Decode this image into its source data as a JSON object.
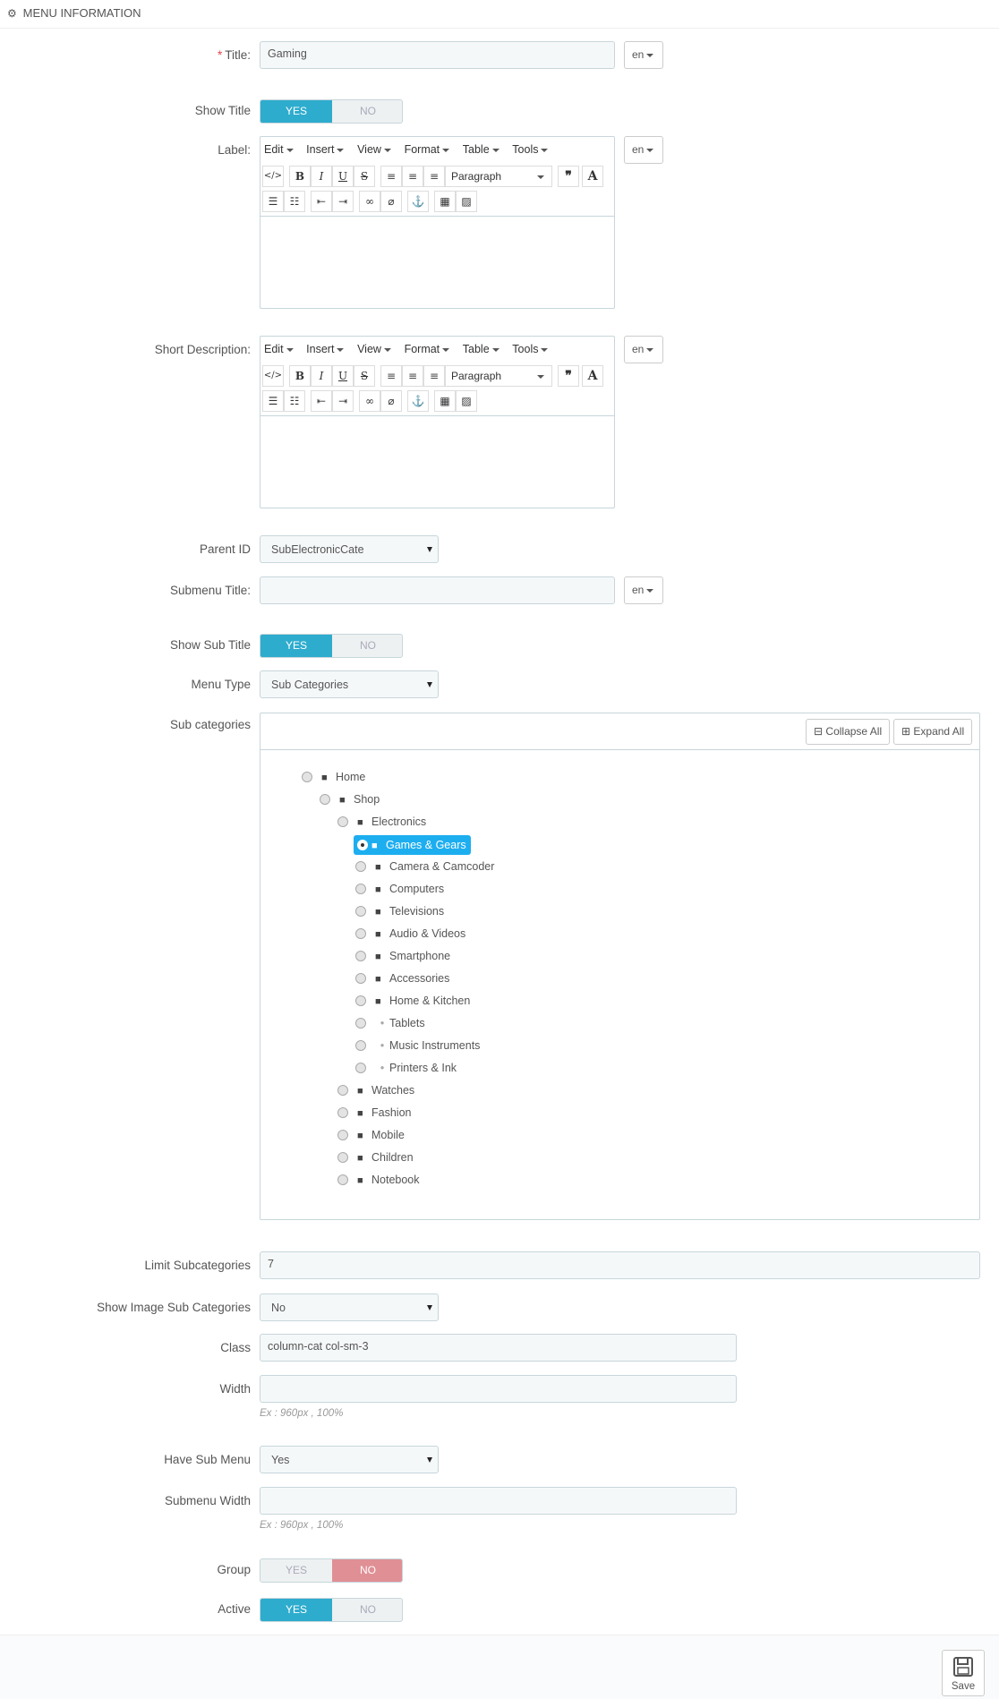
{
  "panel": {
    "heading": "MENU INFORMATION",
    "icon": "cogs-icon"
  },
  "fields": {
    "title": {
      "label": "Title:",
      "required_mark": "*",
      "value": "Gaming",
      "lang": "en"
    },
    "show_title": {
      "label": "Show Title",
      "yes": "YES",
      "no": "NO",
      "selected": "YES"
    },
    "label": {
      "label": "Label:",
      "lang": "en"
    },
    "short_description": {
      "label": "Short Description:",
      "lang": "en"
    },
    "parent_id": {
      "label": "Parent ID",
      "value": "SubElectronicCate"
    },
    "submenu_title": {
      "label": "Submenu Title:",
      "value": "",
      "lang": "en"
    },
    "show_sub_title": {
      "label": "Show Sub Title",
      "yes": "YES",
      "no": "NO",
      "selected": "YES"
    },
    "menu_type": {
      "label": "Menu Type",
      "value": "Sub Categories"
    },
    "sub_categories": {
      "label": "Sub categories",
      "collapse_all": "Collapse All",
      "expand_all": "Expand All"
    },
    "limit_subcategories": {
      "label": "Limit Subcategories",
      "value": "7"
    },
    "show_image_sub_categories": {
      "label": "Show Image Sub Categories",
      "value": "No"
    },
    "class": {
      "label": "Class",
      "value": "column-cat col-sm-3"
    },
    "width": {
      "label": "Width",
      "value": "",
      "help": "Ex : 960px , 100%"
    },
    "have_sub_menu": {
      "label": "Have Sub Menu",
      "value": "Yes"
    },
    "submenu_width": {
      "label": "Submenu Width",
      "value": "",
      "help": "Ex : 960px , 100%"
    },
    "group": {
      "label": "Group",
      "yes": "YES",
      "no": "NO",
      "selected": "NO"
    },
    "active": {
      "label": "Active",
      "yes": "YES",
      "no": "NO",
      "selected": "YES"
    }
  },
  "editor": {
    "menus": [
      "Edit",
      "Insert",
      "View",
      "Format",
      "Table",
      "Tools"
    ],
    "format_select": "Paragraph"
  },
  "tree": [
    {
      "name": "Home",
      "type": "folder-open",
      "level": 0
    },
    {
      "name": "Shop",
      "type": "folder-open",
      "level": 1
    },
    {
      "name": "Electronics",
      "type": "folder-open",
      "level": 2
    },
    {
      "name": "Games & Gears",
      "type": "folder",
      "level": 3,
      "selected": true
    },
    {
      "name": "Camera & Camcoder",
      "type": "folder",
      "level": 3
    },
    {
      "name": "Computers",
      "type": "folder",
      "level": 3
    },
    {
      "name": "Televisions",
      "type": "folder",
      "level": 3
    },
    {
      "name": "Audio & Videos",
      "type": "folder",
      "level": 3
    },
    {
      "name": "Smartphone",
      "type": "folder",
      "level": 3
    },
    {
      "name": "Accessories",
      "type": "folder",
      "level": 3
    },
    {
      "name": "Home & Kitchen",
      "type": "folder",
      "level": 3
    },
    {
      "name": "Tablets",
      "type": "leaf",
      "level": 3
    },
    {
      "name": "Music Instruments",
      "type": "leaf",
      "level": 3
    },
    {
      "name": "Printers & Ink",
      "type": "leaf",
      "level": 3
    },
    {
      "name": "Watches",
      "type": "folder",
      "level": 2
    },
    {
      "name": "Fashion",
      "type": "folder",
      "level": 2
    },
    {
      "name": "Mobile",
      "type": "folder",
      "level": 2
    },
    {
      "name": "Children",
      "type": "folder",
      "level": 2
    },
    {
      "name": "Notebook",
      "type": "folder",
      "level": 2
    }
  ],
  "footer": {
    "save_label": "Save"
  },
  "colors": {
    "accent_yes": "#2eacce",
    "accent_no": "#e08f95",
    "tree_selected": "#1daef0"
  }
}
